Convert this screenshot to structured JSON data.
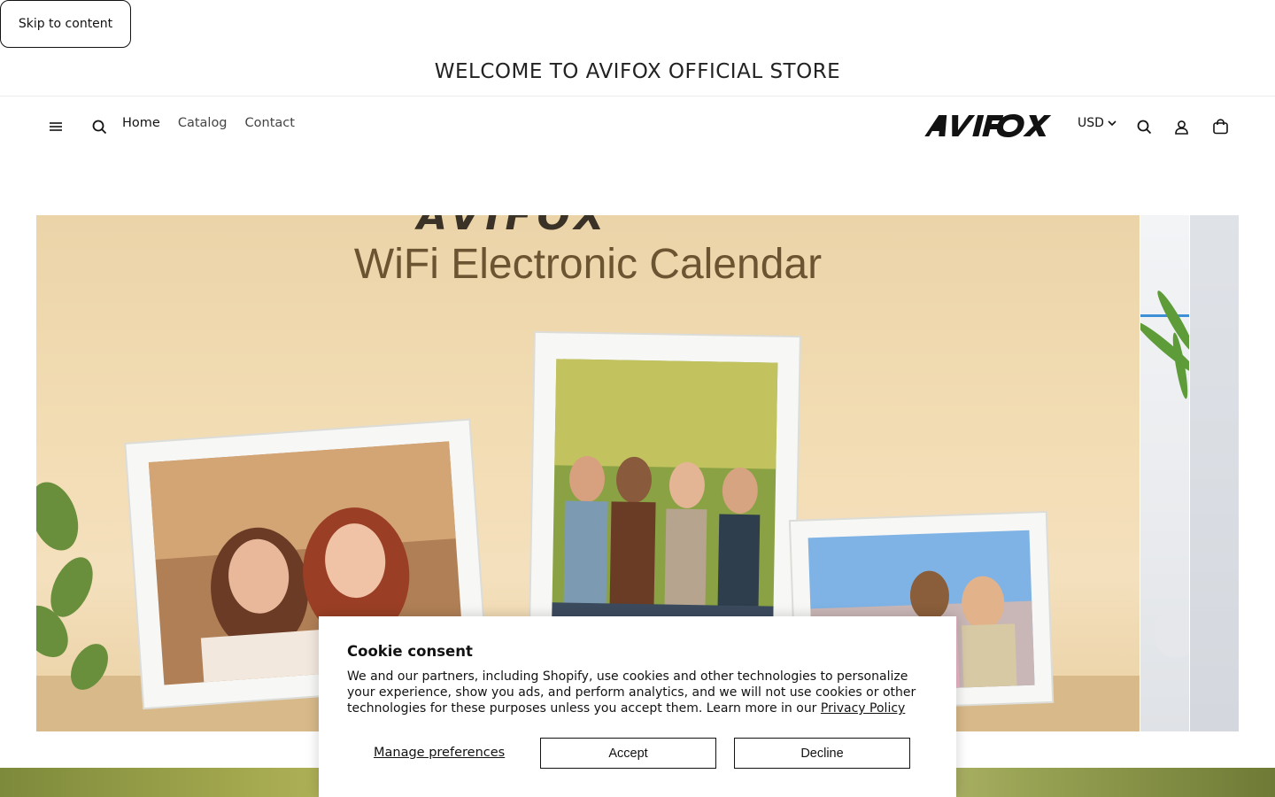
{
  "skip_link": "Skip to content",
  "announcement": "WELCOME TO AVIFOX OFFICIAL STORE",
  "header": {
    "nav": [
      "Home",
      "Catalog",
      "Contact"
    ],
    "logo_text": "AVIFOX",
    "currency": "USD",
    "icons": [
      "menu-icon",
      "search-icon",
      "account-icon",
      "cart-icon"
    ]
  },
  "hero": {
    "brand_partial": "AVIFOX",
    "title": "WiFi Electronic Calendar"
  },
  "cookie": {
    "title": "Cookie consent",
    "text": "We and our partners, including Shopify, use cookies and other technologies to personalize your experience, show you ads, and perform analytics, and we will not use cookies or other technologies for these purposes unless you accept them. Learn more in our ",
    "link": "Privacy Policy",
    "manage": "Manage preferences",
    "accept": "Accept",
    "decline": "Decline"
  }
}
